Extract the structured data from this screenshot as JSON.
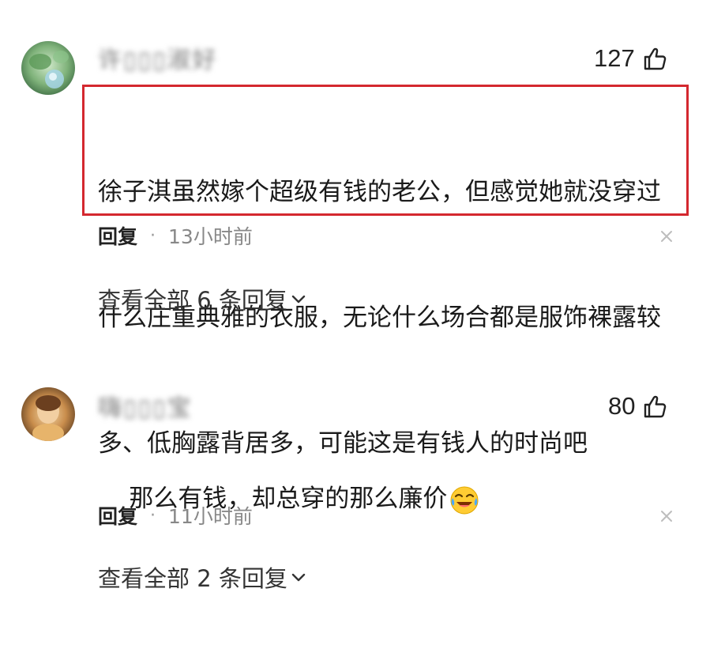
{
  "comments": [
    {
      "username": "许▯▯▯淑好",
      "likes": "127",
      "text": "徐子淇虽然嫁个超级有钱的老公，但感觉她就没穿过什么庄重典雅的衣服，无论什么场合都是服饰裸露较多、低胸露背居多，可能这是有钱人的时尚吧",
      "line1": "徐子淇虽然嫁个超级有钱的老公，但感觉她就没穿过",
      "line2": "什么庄重典雅的衣服，无论什么场合都是服饰裸露较",
      "line3": "多、低胸露背居多，可能这是有钱人的时尚吧",
      "reply_label": "回复",
      "separator": "·",
      "time": "13小时前",
      "view_all": "查看全部 6 条回复",
      "highlighted": true
    },
    {
      "username": "嗨▯▯▯宝",
      "likes": "80",
      "text": "那么有钱，却总穿的那么廉价",
      "reply_label": "回复",
      "separator": "·",
      "time": "11小时前",
      "view_all": "查看全部 2 条回复",
      "emoji": "laughing-crying-emoji"
    }
  ],
  "colors": {
    "highlight_border": "#d4282f",
    "text_primary": "#1a1a1a",
    "text_secondary": "#888888"
  },
  "icons": {
    "like": "thumbs-up-icon",
    "close": "close-icon",
    "expand": "chevron-down-icon"
  }
}
